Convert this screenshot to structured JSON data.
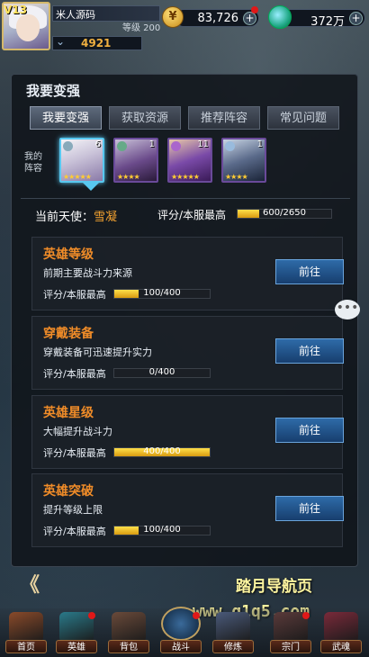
{
  "player": {
    "vip": "V13",
    "name": "米人源码",
    "level": "等级 200",
    "power": "4921"
  },
  "resources": {
    "gold": "83,726",
    "gems": "372万",
    "plus": "+"
  },
  "panel": {
    "title": "我要变强",
    "tabs": [
      "我要变强",
      "获取资源",
      "推荐阵容",
      "常见问题"
    ],
    "team_label": "我的阵容",
    "heroes": [
      {
        "count": "6",
        "stars": "★★★★★"
      },
      {
        "count": "1",
        "stars": "★★★★"
      },
      {
        "count": "11",
        "stars": "★★★★★"
      },
      {
        "count": "1",
        "stars": "★★★★"
      }
    ],
    "angel_label": "当前天使：",
    "angel_name": "雪凝",
    "rating_label": "评分/本服最高",
    "rating_text": "600/2650",
    "rating_value": 600,
    "rating_max": 2650
  },
  "cards": [
    {
      "title": "英雄等级",
      "desc": "前期主要战斗力来源",
      "rating_label": "评分/本服最高",
      "value": 100,
      "max": 400,
      "text": "100/400",
      "button": "前往"
    },
    {
      "title": "穿戴装备",
      "desc": "穿戴装备可迅速提升实力",
      "rating_label": "评分/本服最高",
      "value": 0,
      "max": 400,
      "text": "0/400",
      "button": "前往"
    },
    {
      "title": "英雄星级",
      "desc": "大幅提升战斗力",
      "rating_label": "评分/本服最高",
      "value": 400,
      "max": 400,
      "text": "400/400",
      "button": "前往"
    },
    {
      "title": "英雄突破",
      "desc": "提升等级上限",
      "rating_label": "评分/本服最高",
      "value": 100,
      "max": 400,
      "text": "100/400",
      "button": "前往"
    }
  ],
  "back_label": "《",
  "watermark": {
    "line1": "踏月导航页",
    "line2": "www.q1q5.com"
  },
  "nav": [
    {
      "label": "首页",
      "badge": false
    },
    {
      "label": "英雄",
      "badge": true
    },
    {
      "label": "背包",
      "badge": false
    },
    {
      "label": "战斗",
      "badge": true
    },
    {
      "label": "修炼",
      "badge": false
    },
    {
      "label": "宗门",
      "badge": true
    },
    {
      "label": "武魂",
      "badge": false
    }
  ],
  "colors": {
    "accent_orange": "#f08c28",
    "bar_gold": "#ffd030",
    "button_blue": "#2e6ba8",
    "selection_cyan": "#58c8f0"
  }
}
